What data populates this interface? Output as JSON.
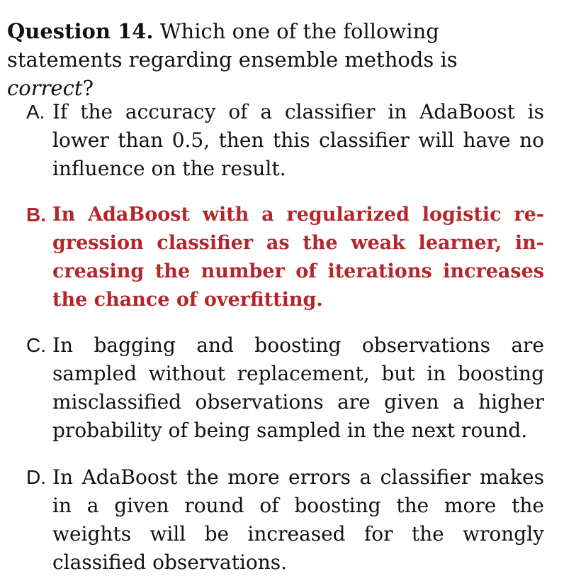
{
  "question": {
    "label": "Question 14.",
    "text_before": "Which one of the following statements regarding ensemble methods is ",
    "emphasis": "correct",
    "text_after": "?"
  },
  "options": [
    {
      "letter": "A.",
      "text": "If the accuracy of a classifier in AdaBoost is lower than 0.5, then this classifier will have no influence on the result.",
      "correct": false
    },
    {
      "letter": "B.",
      "text": "In AdaBoost with a regularized logistic re­gression classifier as the weak learner, in­creasing the number of iterations increases the chance of overfitting.",
      "correct": true
    },
    {
      "letter": "C.",
      "text": "In bagging and boosting observations are sampled without replacement, but in boosting misclassified observations are given a higher probability of be­ing sampled in the next round.",
      "correct": false
    },
    {
      "letter": "D.",
      "text": "In AdaBoost the more errors a classifier makes in a given round of boosting the more the weights will be increased for the wrongly classified obser­vations.",
      "correct": false
    }
  ],
  "colors": {
    "correct_answer": "#b3262b",
    "text": "#111111"
  }
}
